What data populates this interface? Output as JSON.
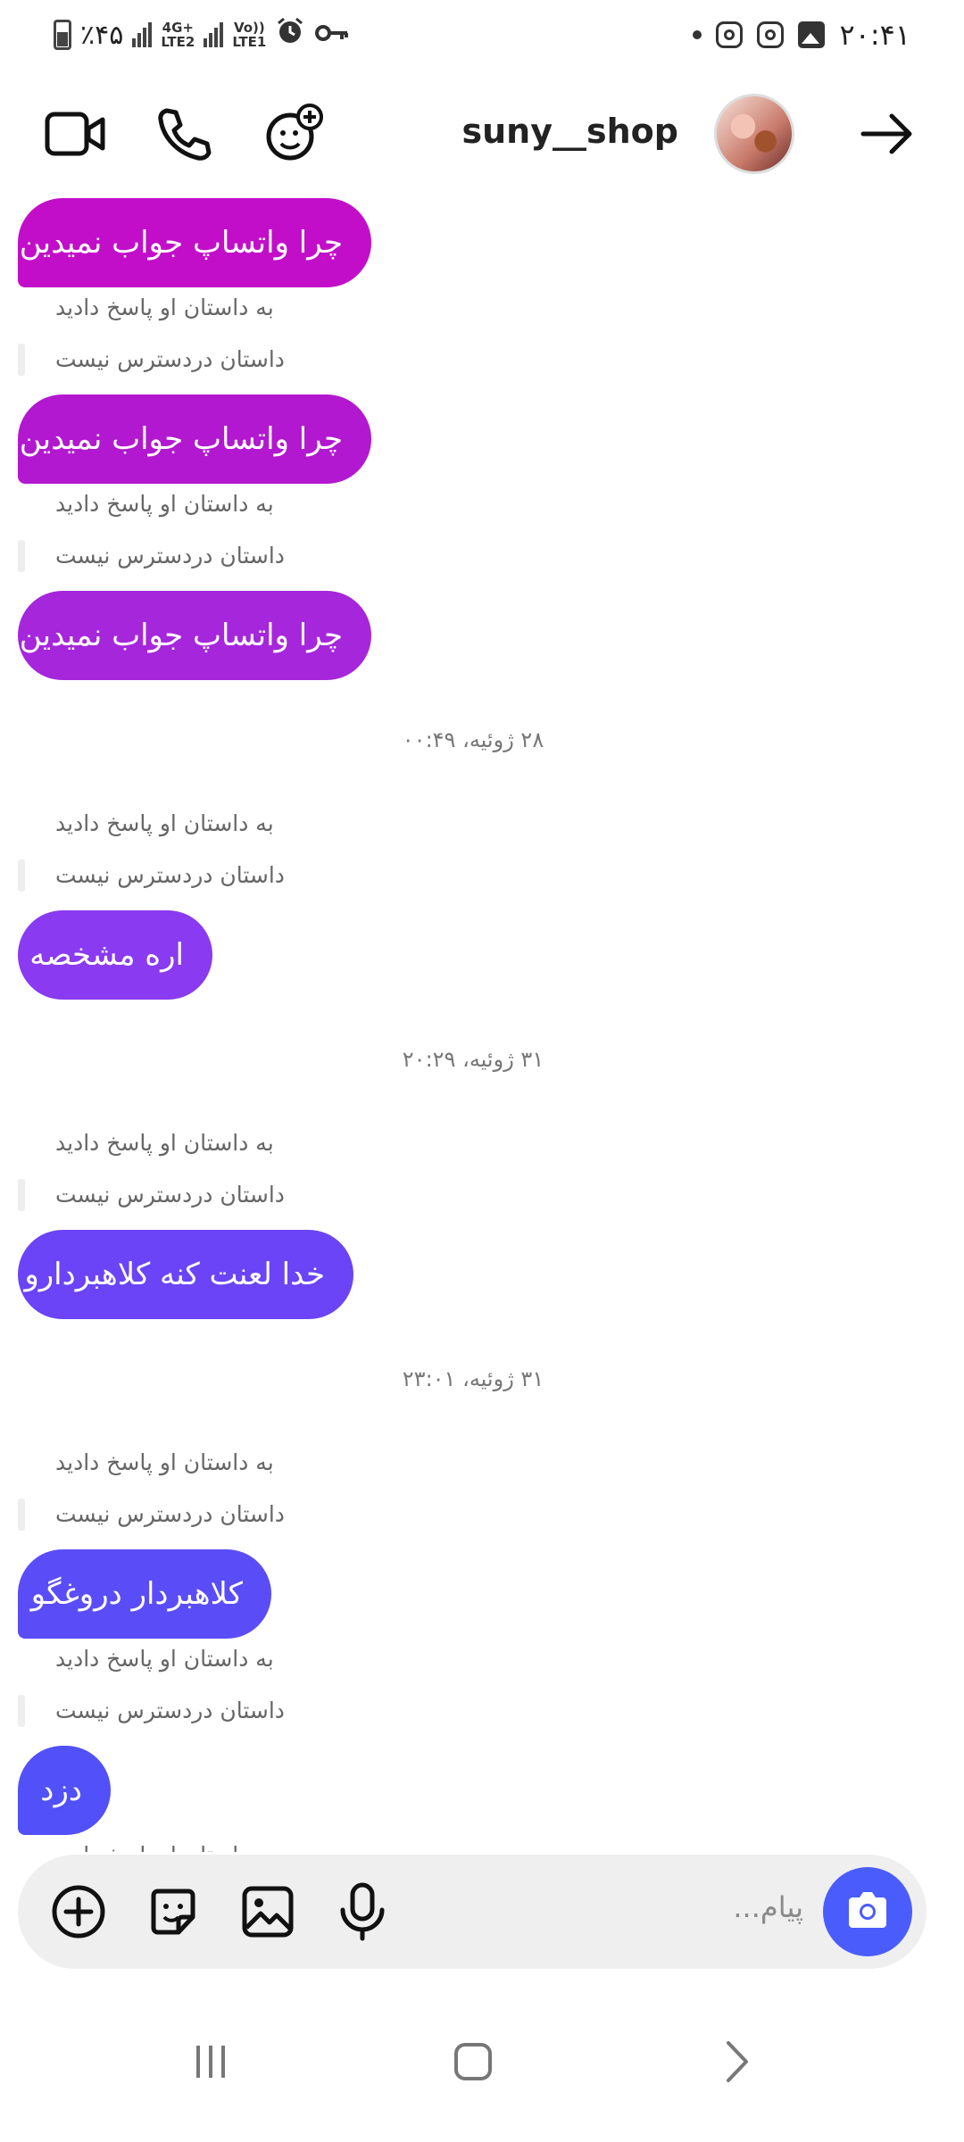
{
  "status_bar": {
    "battery_text": "٪۴۵",
    "net1": "4G+",
    "net1_sub": "LTE2",
    "net2": "Vo))",
    "net2_sub": "LTE1",
    "time": "۲۰:۴۱",
    "icons": [
      "battery-icon",
      "signal-icon",
      "alarm-icon",
      "key-icon",
      "instagram-icon",
      "instagram-icon",
      "gallery-icon"
    ]
  },
  "header": {
    "username": "suny__shop",
    "icons": [
      "video-call-icon",
      "phone-icon",
      "add-effect-icon",
      "back-arrow-icon"
    ]
  },
  "chat": {
    "messages": [
      {
        "text": "چرا واتساپ جواب نمیدین",
        "color": "#c20ec9"
      },
      {
        "text": "چرا واتساپ جواب نمیدین",
        "color": "#b218d0"
      },
      {
        "text": "چرا واتساپ جواب نمیدین",
        "color": "#a626dc"
      },
      {
        "text": "اره مشخصه",
        "color": "#8a3af0"
      },
      {
        "text": "خدا لعنت کنه کلاهبردارو",
        "color": "#6a44f6"
      },
      {
        "text": "کلاهبردار دروغگو",
        "color": "#5a4df8"
      },
      {
        "text": "دزد",
        "color": "#5250f9"
      }
    ],
    "reply_label": "به داستان او پاسخ دادید",
    "story_unavailable": "داستان دردسترس نیست",
    "timestamps": [
      "۲۸ ژوئیه، ۰۰:۴۹",
      "۳۱ ژوئیه، ۲۰:۲۹",
      "۳۱ ژوئیه، ۲۳:۰۱"
    ]
  },
  "composer": {
    "placeholder": "پیام...",
    "icons": [
      "add-icon",
      "sticker-icon",
      "gallery-icon",
      "microphone-icon",
      "camera-icon"
    ],
    "accent": "#4a5dfc"
  },
  "nav": {
    "icons": [
      "recent-apps-icon",
      "home-icon",
      "back-icon"
    ]
  }
}
